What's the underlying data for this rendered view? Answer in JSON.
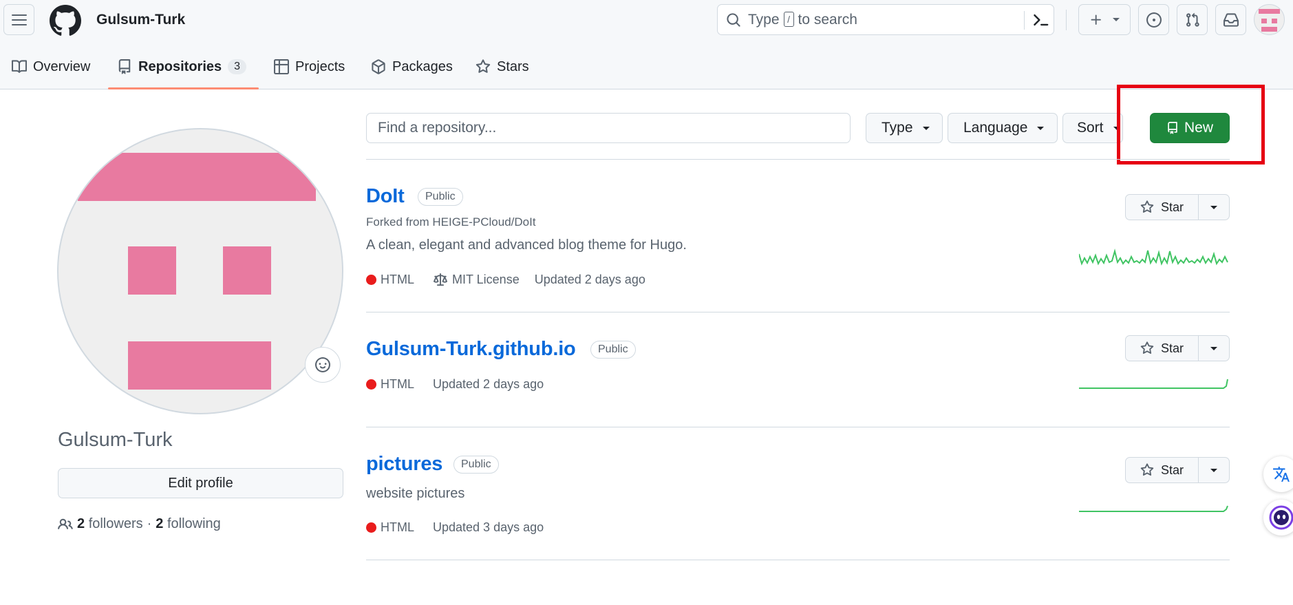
{
  "header": {
    "title": "Gulsum-Turk",
    "search": {
      "prefix": "Type",
      "key": "/",
      "suffix": "to search"
    }
  },
  "tabs": [
    {
      "label": "Overview",
      "icon": "book-icon"
    },
    {
      "label": "Repositories",
      "icon": "repo-icon",
      "count": "3",
      "selected": true
    },
    {
      "label": "Projects",
      "icon": "table-icon"
    },
    {
      "label": "Packages",
      "icon": "package-icon"
    },
    {
      "label": "Stars",
      "icon": "star-icon"
    }
  ],
  "profile": {
    "name": "Gulsum-Turk",
    "edit_label": "Edit profile",
    "followers_count": "2",
    "followers_label": "followers",
    "separator": "·",
    "following_count": "2",
    "following_label": "following"
  },
  "toolbar": {
    "find_placeholder": "Find a repository...",
    "type_label": "Type",
    "language_label": "Language",
    "sort_label": "Sort",
    "new_label": "New"
  },
  "repos": [
    {
      "name": "DoIt",
      "visibility": "Public",
      "forked_from": "Forked from HEIGE-PCloud/DoIt",
      "description": "A clean, elegant and advanced blog theme for Hugo.",
      "language": "HTML",
      "license": "MIT License",
      "updated": "Updated 2 days ago",
      "star_label": "Star"
    },
    {
      "name": "Gulsum-Turk.github.io",
      "visibility": "Public",
      "language": "HTML",
      "updated": "Updated 2 days ago",
      "star_label": "Star"
    },
    {
      "name": "pictures",
      "visibility": "Public",
      "description": "website pictures",
      "language": "HTML",
      "updated": "Updated 3 days ago",
      "star_label": "Star"
    }
  ],
  "colors": {
    "accent_green": "#1f883d",
    "link_blue": "#0969da",
    "html_language": "#e91c1c",
    "highlight_box": "#e60012",
    "avatar_pink": "#e87aa0",
    "sparkline": "#40c463"
  }
}
